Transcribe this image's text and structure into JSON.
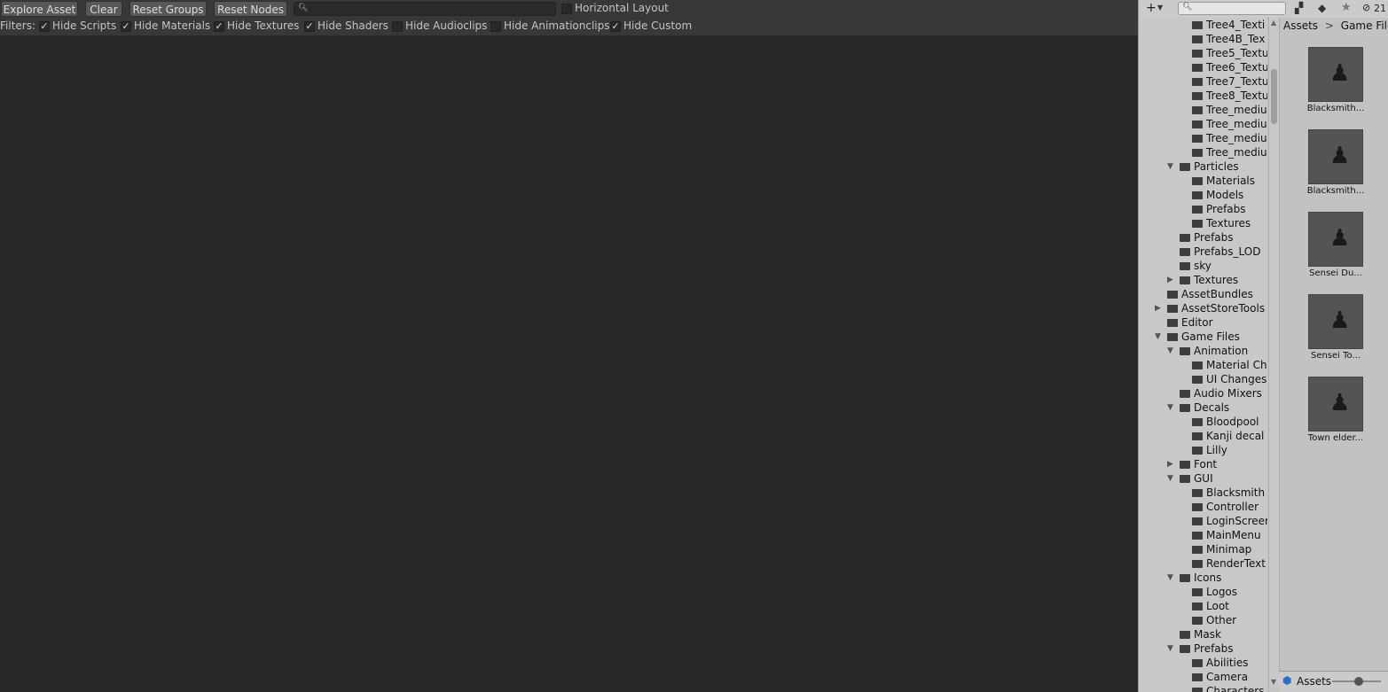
{
  "toolbar": {
    "explore_asset": "Explore Asset",
    "clear": "Clear",
    "reset_groups": "Reset Groups",
    "reset_nodes": "Reset Nodes",
    "search_value": "",
    "horizontal_layout": "Horizontal Layout"
  },
  "filters": {
    "label": "Filters:",
    "items": [
      {
        "label": "Hide Scripts",
        "checked": true
      },
      {
        "label": "Hide Materials",
        "checked": true
      },
      {
        "label": "Hide Textures",
        "checked": true
      },
      {
        "label": "Hide Shaders",
        "checked": true
      },
      {
        "label": "Hide Audioclips",
        "checked": false
      },
      {
        "label": "Hide Animationclips",
        "checked": false
      },
      {
        "label": "Hide Custom",
        "checked": true
      }
    ]
  },
  "project": {
    "hidden_count": "21",
    "tree": [
      {
        "label": "Tree4_Texti",
        "level": 3
      },
      {
        "label": "Tree4B_Tex",
        "level": 3
      },
      {
        "label": "Tree5_Textu",
        "level": 3
      },
      {
        "label": "Tree6_Textu",
        "level": 3
      },
      {
        "label": "Tree7_Textu",
        "level": 3
      },
      {
        "label": "Tree8_Textu",
        "level": 3
      },
      {
        "label": "Tree_mediu",
        "level": 3
      },
      {
        "label": "Tree_mediu",
        "level": 3
      },
      {
        "label": "Tree_mediu",
        "level": 3
      },
      {
        "label": "Tree_mediu",
        "level": 3
      },
      {
        "label": "Particles",
        "level": 2,
        "arrow": "open"
      },
      {
        "label": "Materials",
        "level": 3
      },
      {
        "label": "Models",
        "level": 3
      },
      {
        "label": "Prefabs",
        "level": 3
      },
      {
        "label": "Textures",
        "level": 3
      },
      {
        "label": "Prefabs",
        "level": 2
      },
      {
        "label": "Prefabs_LOD",
        "level": 2
      },
      {
        "label": "sky",
        "level": 2
      },
      {
        "label": "Textures",
        "level": 2,
        "arrow": "closed"
      },
      {
        "label": "AssetBundles",
        "level": 1
      },
      {
        "label": "AssetStoreTools",
        "level": 1,
        "arrow": "closed"
      },
      {
        "label": "Editor",
        "level": 1
      },
      {
        "label": "Game Files",
        "level": 1,
        "arrow": "open"
      },
      {
        "label": "Animation",
        "level": 2,
        "arrow": "open"
      },
      {
        "label": "Material Ch",
        "level": 3
      },
      {
        "label": "UI Changes",
        "level": 3
      },
      {
        "label": "Audio Mixers",
        "level": 2
      },
      {
        "label": "Decals",
        "level": 2,
        "arrow": "open"
      },
      {
        "label": "Bloodpool",
        "level": 3
      },
      {
        "label": "Kanji decal",
        "level": 3
      },
      {
        "label": "Lilly",
        "level": 3
      },
      {
        "label": "Font",
        "level": 2,
        "arrow": "closed"
      },
      {
        "label": "GUI",
        "level": 2,
        "arrow": "open"
      },
      {
        "label": "Blacksmith",
        "level": 3
      },
      {
        "label": "Controller",
        "level": 3
      },
      {
        "label": "LoginScreer",
        "level": 3
      },
      {
        "label": "MainMenu",
        "level": 3
      },
      {
        "label": "Minimap",
        "level": 3
      },
      {
        "label": "RenderText",
        "level": 3
      },
      {
        "label": "Icons",
        "level": 2,
        "arrow": "open"
      },
      {
        "label": "Logos",
        "level": 3
      },
      {
        "label": "Loot",
        "level": 3
      },
      {
        "label": "Other",
        "level": 3
      },
      {
        "label": "Mask",
        "level": 2
      },
      {
        "label": "Prefabs",
        "level": 2,
        "arrow": "open"
      },
      {
        "label": "Abilities",
        "level": 3
      },
      {
        "label": "Camera",
        "level": 3
      },
      {
        "label": "Characters",
        "level": 3
      }
    ],
    "breadcrumb": {
      "root": "Assets",
      "sep": ">",
      "current": "Game Files"
    },
    "assets": [
      {
        "name": "Blacksmith..."
      },
      {
        "name": "Blacksmith..."
      },
      {
        "name": "Sensei Du..."
      },
      {
        "name": "Sensei To..."
      },
      {
        "name": "Town elder..."
      }
    ],
    "bottom_label": "Assets"
  }
}
